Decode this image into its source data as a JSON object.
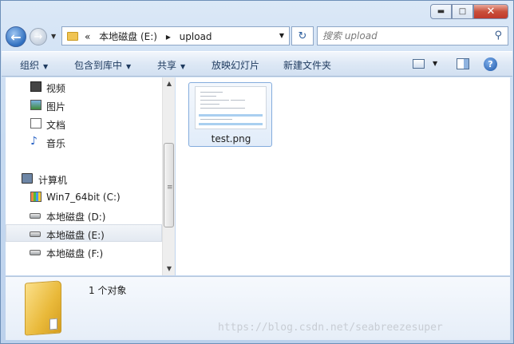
{
  "window": {
    "caption_buttons": {
      "minimize": "▬",
      "maximize": "□",
      "close": "✕"
    }
  },
  "navigation": {
    "back_icon": "back-arrow-icon",
    "forward_icon": "forward-arrow-icon",
    "back_glyph": "←",
    "forward_glyph": "→",
    "address": {
      "overflow": "«",
      "drive": "本地磁盘 (E:)",
      "separator": "▸",
      "folder": "upload"
    },
    "refresh_glyph": "↻",
    "search": {
      "placeholder": "搜索 upload",
      "icon": "search-icon"
    }
  },
  "toolbar": {
    "organize": "组织",
    "include_in_library": "包含到库中",
    "share": "共享",
    "slideshow": "放映幻灯片",
    "new_folder": "新建文件夹",
    "help": "?"
  },
  "navpane": {
    "items": [
      {
        "label": "视频",
        "icon": "video-library-icon"
      },
      {
        "label": "图片",
        "icon": "pictures-library-icon"
      },
      {
        "label": "文档",
        "icon": "documents-library-icon"
      },
      {
        "label": "音乐",
        "icon": "music-library-icon"
      },
      {
        "label": "计算机",
        "icon": "computer-icon"
      },
      {
        "label": "Win7_64bit (C:)",
        "icon": "system-drive-icon"
      },
      {
        "label": "本地磁盘 (D:)",
        "icon": "drive-icon"
      },
      {
        "label": "本地磁盘 (E:)",
        "icon": "drive-icon",
        "selected": true
      },
      {
        "label": "本地磁盘 (F:)",
        "icon": "drive-icon"
      }
    ],
    "music_glyph": "♪"
  },
  "scrollbar": {
    "up": "▲",
    "down": "▼",
    "grip": "≡"
  },
  "content": {
    "files": [
      {
        "name": "test.png"
      }
    ]
  },
  "details": {
    "count_text": "1 个对象"
  },
  "watermark": "https://blog.csdn.net/seabreezesuper"
}
